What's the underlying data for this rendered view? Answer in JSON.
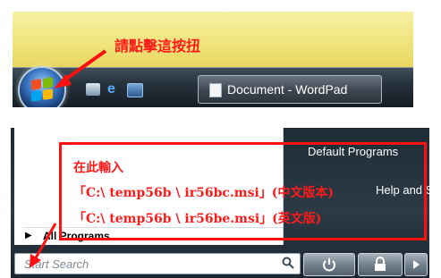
{
  "taskbar": {
    "window_button_label": "Document - WordPad",
    "callout": "請點擊這按扭"
  },
  "start_menu": {
    "all_programs": "All Programs",
    "right_items": {
      "default_programs": "Default Programs",
      "help_support": "Help and Support"
    },
    "search_placeholder": "Start Search"
  },
  "annotation": {
    "line1": "在此輸入",
    "line2": "「C:\\ temp56b \\ ir56bc.msi」(中文版本)",
    "line3": "「C:\\ temp56b \\ ir56be.msi」(英文版)"
  },
  "colors": {
    "annotation_red": "#ff1010",
    "taskbar_dark": "#1b232b",
    "desktop_yellow": "#efe37a"
  },
  "icons": [
    "windows-flag-icon",
    "show-desktop-icon",
    "internet-explorer-icon",
    "switch-windows-icon",
    "document-icon",
    "search-icon",
    "power-icon",
    "lock-icon",
    "chevron-right-icon",
    "arrow-right-icon"
  ]
}
